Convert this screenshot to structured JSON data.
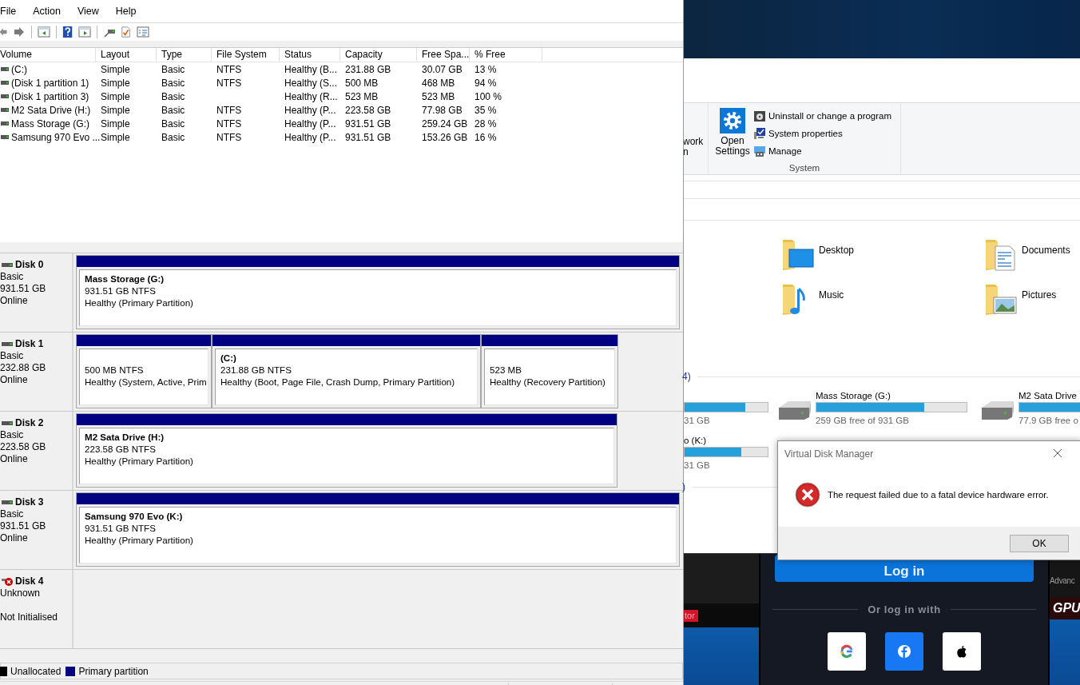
{
  "disk_management": {
    "menu": [
      "File",
      "Action",
      "View",
      "Help"
    ],
    "volumes": {
      "columns": [
        "Volume",
        "Layout",
        "Type",
        "File System",
        "Status",
        "Capacity",
        "Free Spa...",
        "% Free"
      ],
      "rows": [
        {
          "volume": "(C:)",
          "layout": "Simple",
          "type": "Basic",
          "file_system": "NTFS",
          "status": "Healthy (B...",
          "capacity": "231.88 GB",
          "free_space": "30.07 GB",
          "percent_free": "13 %"
        },
        {
          "volume": "(Disk 1 partition 1)",
          "layout": "Simple",
          "type": "Basic",
          "file_system": "NTFS",
          "status": "Healthy (S...",
          "capacity": "500 MB",
          "free_space": "468 MB",
          "percent_free": "94 %"
        },
        {
          "volume": "(Disk 1 partition 3)",
          "layout": "Simple",
          "type": "Basic",
          "status": "Healthy (R...",
          "capacity": "523 MB",
          "free_space": "523 MB",
          "percent_free": "100 %"
        },
        {
          "volume": "M2 Sata Drive (H:)",
          "layout": "Simple",
          "type": "Basic",
          "file_system": "NTFS",
          "status": "Healthy (P...",
          "capacity": "223.58 GB",
          "free_space": "77.98 GB",
          "percent_free": "35 %"
        },
        {
          "volume": "Mass Storage (G:)",
          "layout": "Simple",
          "type": "Basic",
          "file_system": "NTFS",
          "status": "Healthy (P...",
          "capacity": "931.51 GB",
          "free_space": "259.24 GB",
          "percent_free": "28 %"
        },
        {
          "volume": "Samsung 970 Evo ...",
          "layout": "Simple",
          "type": "Basic",
          "file_system": "NTFS",
          "status": "Healthy (P...",
          "capacity": "931.51 GB",
          "free_space": "153.26 GB",
          "percent_free": "16 %"
        }
      ]
    },
    "disks": [
      {
        "name": "Disk 0",
        "kind": "online",
        "type": "Basic",
        "size": "931.51 GB",
        "status": "Online",
        "partitions": [
          {
            "title": "Mass Storage  (G:)",
            "size": "931.51 GB NTFS",
            "status": "Healthy (Primary Partition)"
          }
        ]
      },
      {
        "name": "Disk 1",
        "kind": "online",
        "type": "Basic",
        "size": "232.88 GB",
        "status": "Online",
        "partitions": [
          {
            "size": "500 MB NTFS",
            "status": "Healthy (System, Active, Prim"
          },
          {
            "title": "(C:)",
            "size": "231.88 GB NTFS",
            "status": "Healthy (Boot, Page File, Crash Dump, Primary Partition)"
          },
          {
            "size": "523 MB",
            "status": "Healthy (Recovery Partition)"
          }
        ]
      },
      {
        "name": "Disk 2",
        "kind": "online",
        "type": "Basic",
        "size": "223.58 GB",
        "status": "Online",
        "partitions": [
          {
            "title": "M2 Sata Drive  (H:)",
            "size": "223.58 GB NTFS",
            "status": "Healthy (Primary Partition)"
          }
        ]
      },
      {
        "name": "Disk 3",
        "kind": "online",
        "type": "Basic",
        "size": "931.51 GB",
        "status": "Online",
        "partitions": [
          {
            "title": "Samsung 970 Evo  (K:)",
            "size": "931.51 GB NTFS",
            "status": "Healthy (Primary Partition)"
          }
        ]
      },
      {
        "name": "Disk 4",
        "kind": "error",
        "type": "Unknown",
        "status": "Not Initialised"
      }
    ],
    "legend": [
      {
        "label": "Unallocated",
        "color": "#000000"
      },
      {
        "label": "Primary partition",
        "color": "#000080"
      }
    ]
  },
  "explorer": {
    "ribbon": {
      "cut_labels": [
        "work",
        "n"
      ],
      "open_settings": "Open Settings",
      "items": [
        {
          "kind": "uninstall",
          "label": "Uninstall or change a program"
        },
        {
          "kind": "properties",
          "label": "System properties"
        },
        {
          "kind": "manage",
          "label": "Manage"
        }
      ],
      "group": "System"
    },
    "folders": [
      {
        "kind": "desktop",
        "name": "Desktop"
      },
      {
        "kind": "documents",
        "name": "Documents"
      },
      {
        "kind": "music",
        "name": "Music"
      },
      {
        "kind": "pictures",
        "name": "Pictures"
      }
    ],
    "drives_heading": "4)",
    "drive_rows": [
      [
        {
          "free": "31 GB",
          "level": 0.73
        },
        {
          "name": "Mass Storage (G:)",
          "free": "259 GB free of 931 GB",
          "level": 0.72
        },
        {
          "name": "M2 Sata Drive",
          "free": "77.9 GB free o",
          "level": 1
        }
      ],
      [
        {
          "name": "o (K:)",
          "free": "31 GB",
          "level": 0.68
        }
      ]
    ],
    "next_heading": ")"
  },
  "web_page": {
    "left_badge": "tor",
    "login_button": "Log in",
    "divider_text": "Or log in with",
    "social_buttons": [
      {
        "kind": "google"
      },
      {
        "kind": "facebook"
      },
      {
        "kind": "apple"
      }
    ],
    "right_text": "Advanc",
    "right_logo": "GPU"
  },
  "dialog": {
    "title": "Virtual Disk Manager",
    "message": "The request failed due to a fatal device hardware error.",
    "buttons": [
      "OK"
    ]
  }
}
